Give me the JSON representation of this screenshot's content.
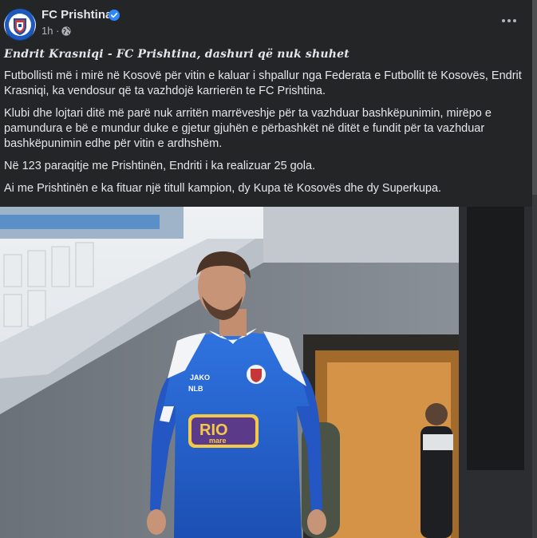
{
  "header": {
    "page_name": "FC Prishtina",
    "time": "1h",
    "time_sep": "·"
  },
  "post": {
    "title": "Endrit Krasniqi - FC Prishtina, dashuri që nuk shuhet",
    "paragraphs": [
      "Futbollisti më i mirë në Kosovë për vitin e kaluar i shpallur nga Federata e Futbollit të Kosovës, Endrit Krasniqi, ka vendosur që ta vazhdojë karrierën te FC Prishtina.",
      "Klubi dhe lojtari ditë më parë nuk arritën marrëveshje për ta vazhduar bashkëpunimin, mirëpo e pamundura e bë e mundur duke e gjetur gjuhën e përbashkët në ditët e fundit për ta vazhduar bashkëpunimin edhe për vitin e ardhshëm.",
      "Në 123 paraqitje me Prishtinën, Endriti i ka realizuar 25 gola.",
      "Ai me Prishtinën e ka fituar një titull kampion, dy Kupa të Kosovës dhe dy Superkupa."
    ]
  },
  "photo": {
    "sponsor_brand": "JAKO",
    "sponsor_bank": "NLB",
    "shirt_sponsor_line1": "RIO",
    "shirt_sponsor_line2": "mare"
  },
  "colors": {
    "background": "#242526",
    "text": "#e4e6eb",
    "secondary_text": "#b0b3b8",
    "verified": "#2d88ff",
    "jersey_blue": "#2463d6"
  },
  "icons": [
    "verified-icon",
    "globe-icon",
    "more-icon"
  ]
}
